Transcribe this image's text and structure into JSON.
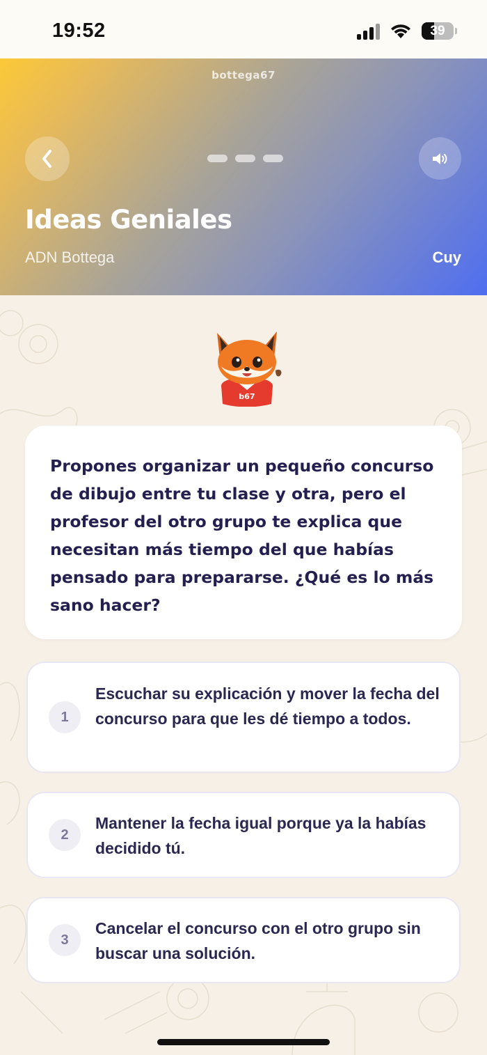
{
  "status_bar": {
    "time": "19:52",
    "battery": "39",
    "battery_level": 0.39
  },
  "header": {
    "brand": "bottega67",
    "title": "Ideas Geniales",
    "subtitle": "ADN Bottega",
    "character_name": "Cuy",
    "progress_steps": 3,
    "gradient_colors": [
      "#fcc937",
      "#a7a39a",
      "#4f6ef0"
    ]
  },
  "mascot": {
    "icon": "fox-mascot-icon",
    "badge_text": "b67"
  },
  "question": {
    "text": "Propones organizar un pequeño concurso de dibujo entre tu clase y otra, pero el profesor del otro grupo te explica que necesitan más tiempo del que habías pensado para prepararse. ¿Qué es lo más sano hacer?"
  },
  "options": [
    {
      "number": "1",
      "text": "Escuchar su explicación y mover la fecha del concurso para que les dé tiempo a todos."
    },
    {
      "number": "2",
      "text": "Mantener la fecha igual porque ya la habías decidido tú."
    },
    {
      "number": "3",
      "text": "Cancelar el concurso con el otro grupo sin buscar una solución."
    }
  ],
  "colors": {
    "background": "#f6f0e7",
    "text_dark": "#231f4f",
    "option_border": "#e8e6f2"
  }
}
